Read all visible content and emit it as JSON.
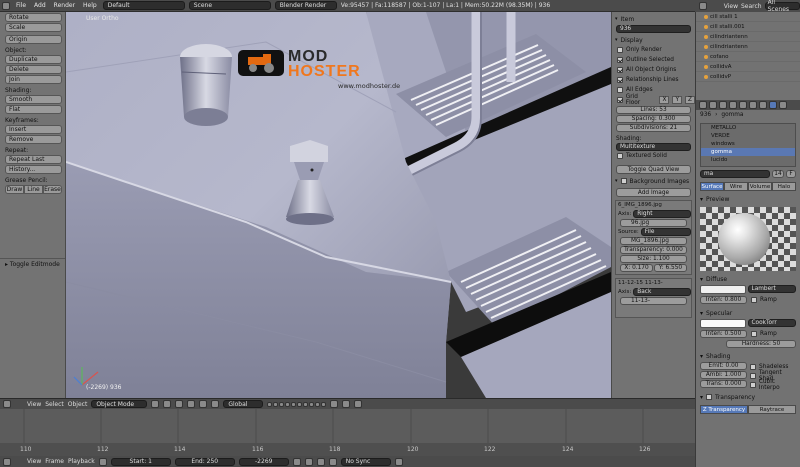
{
  "topbar": {
    "menus": [
      "File",
      "Add",
      "Render",
      "Help"
    ],
    "screen_layout": "Default",
    "scene": "Scene",
    "render_engine": "Blender Render",
    "stats": "Ve:95457 | Fa:118587 | Ob:1-107 | La:1 | Mem:50.22M (98.35M) | 936"
  },
  "tool_shelf": {
    "top_buttons": [
      "Rotate",
      "Scale"
    ],
    "origin_button": "Origin",
    "object_header": "Object:",
    "object_buttons": [
      "Duplicate",
      "Delete",
      "Join"
    ],
    "shading_header": "Shading:",
    "shading_buttons": [
      "Smooth",
      "Flat"
    ],
    "keyframes_header": "Keyframes:",
    "keyframe_buttons": [
      "Insert",
      "Remove"
    ],
    "repeat_header": "Repeat:",
    "repeat_buttons": [
      "Repeat Last",
      "History..."
    ],
    "grease_header": "Grease Pencil:",
    "grease_buttons": [
      "Draw",
      "Line",
      "Erase"
    ],
    "toggle_editmode": "Toggle Editmode"
  },
  "viewport": {
    "label": "User Ortho",
    "frame_info": "(-2269) 936",
    "watermark": {
      "line1": "MOD",
      "line2": "HOSTER",
      "url": "www.modhoster.de"
    }
  },
  "properties_panel": {
    "item_header": "Item",
    "item_name": "936",
    "display_header": "Display",
    "display_options": [
      {
        "label": "Only Render",
        "checked": false
      },
      {
        "label": "Outline Selected",
        "checked": true
      },
      {
        "label": "All Object Origins",
        "checked": true
      },
      {
        "label": "Relationship Lines",
        "checked": true
      },
      {
        "label": "All Edges",
        "checked": false
      }
    ],
    "grid_floor": "Grid Floor",
    "axes": [
      "X",
      "Y",
      "Z"
    ],
    "lines": "Lines: 53",
    "spacing": "Spacing: 0.300",
    "subdivisions": "Subdivisions: 21",
    "shading_label": "Shading:",
    "shading_value": "Multitexture",
    "textured_solid": "Textured Solid",
    "toggle_quad": "Toggle Quad View",
    "background_header": "Background Images",
    "add_image": "Add Image",
    "bg1": {
      "name": "6_IMG_1896.jpg",
      "axis_label": "Axis:",
      "axis_value": "Right",
      "file": "96.jpg",
      "source_label": "Source:",
      "source_value": "File",
      "image_file": "MG_1896.jpg",
      "transparency": "Transparency: 0.000",
      "size": "Size: 1.100",
      "x": "X: 0.170",
      "y": "Y: 6.550"
    },
    "bg2": {
      "name": "11-12-15 11-13-",
      "axis_label": "Axis:",
      "axis_value": "Back",
      "file": "11-13-"
    }
  },
  "outliner": {
    "header_items": [
      "View",
      "Search",
      "All Scenes"
    ],
    "rows": [
      "cill stalli 1",
      "cill stalli.001",
      "cilindriantenn",
      "cilindriantenn",
      "cofano",
      "collidvA",
      "collidvP"
    ]
  },
  "material_panel": {
    "object_name": "936",
    "material_name": "gomma",
    "materials": [
      {
        "name": "METALLO",
        "selected": false
      },
      {
        "name": "VERDE",
        "selected": false
      },
      {
        "name": "windows",
        "selected": false
      },
      {
        "name": "gomma",
        "selected": true
      },
      {
        "name": "lucido",
        "selected": false
      }
    ],
    "slot_field": "ma",
    "users": "14",
    "flag": "F",
    "tabs": [
      {
        "label": "Surface",
        "active": true
      },
      {
        "label": "Wire",
        "active": false
      },
      {
        "label": "Volume",
        "active": false
      },
      {
        "label": "Halo",
        "active": false
      }
    ],
    "preview_header": "Preview",
    "diffuse_header": "Diffuse",
    "diffuse_shader": "Lambert",
    "diffuse_intensity": "Inten: 0.800",
    "ramp": "Ramp",
    "specular_header": "Specular",
    "specular_shader": "CookTorr",
    "specular_intensity": "Inten: 0.500",
    "hardness": "Hardness: 50",
    "shading_header": "Shading",
    "emit": "Emit: 0.00",
    "ambient": "Ambi: 1.000",
    "translucency": "Trans: 0.000",
    "shadeless": "Shadeless",
    "tangent": "Tangent Shad",
    "cubic": "Cubic Interpo",
    "transparency_header": "Transparency",
    "transparency_modes": [
      "Z Transparency",
      "Raytrace"
    ]
  },
  "view_header": {
    "menus": [
      "View",
      "Select",
      "Object"
    ],
    "mode": "Object Mode",
    "orientation": "Global"
  },
  "timeline": {
    "ticks": [
      "110",
      "112",
      "114",
      "116",
      "118",
      "120",
      "122",
      "124",
      "126",
      "128",
      "130"
    ]
  },
  "timeline_header": {
    "menus": [
      "View",
      "Frame",
      "Playback"
    ],
    "start": "Start: 1",
    "end": "End: 250",
    "current": "-2269",
    "sync": "No Sync"
  }
}
